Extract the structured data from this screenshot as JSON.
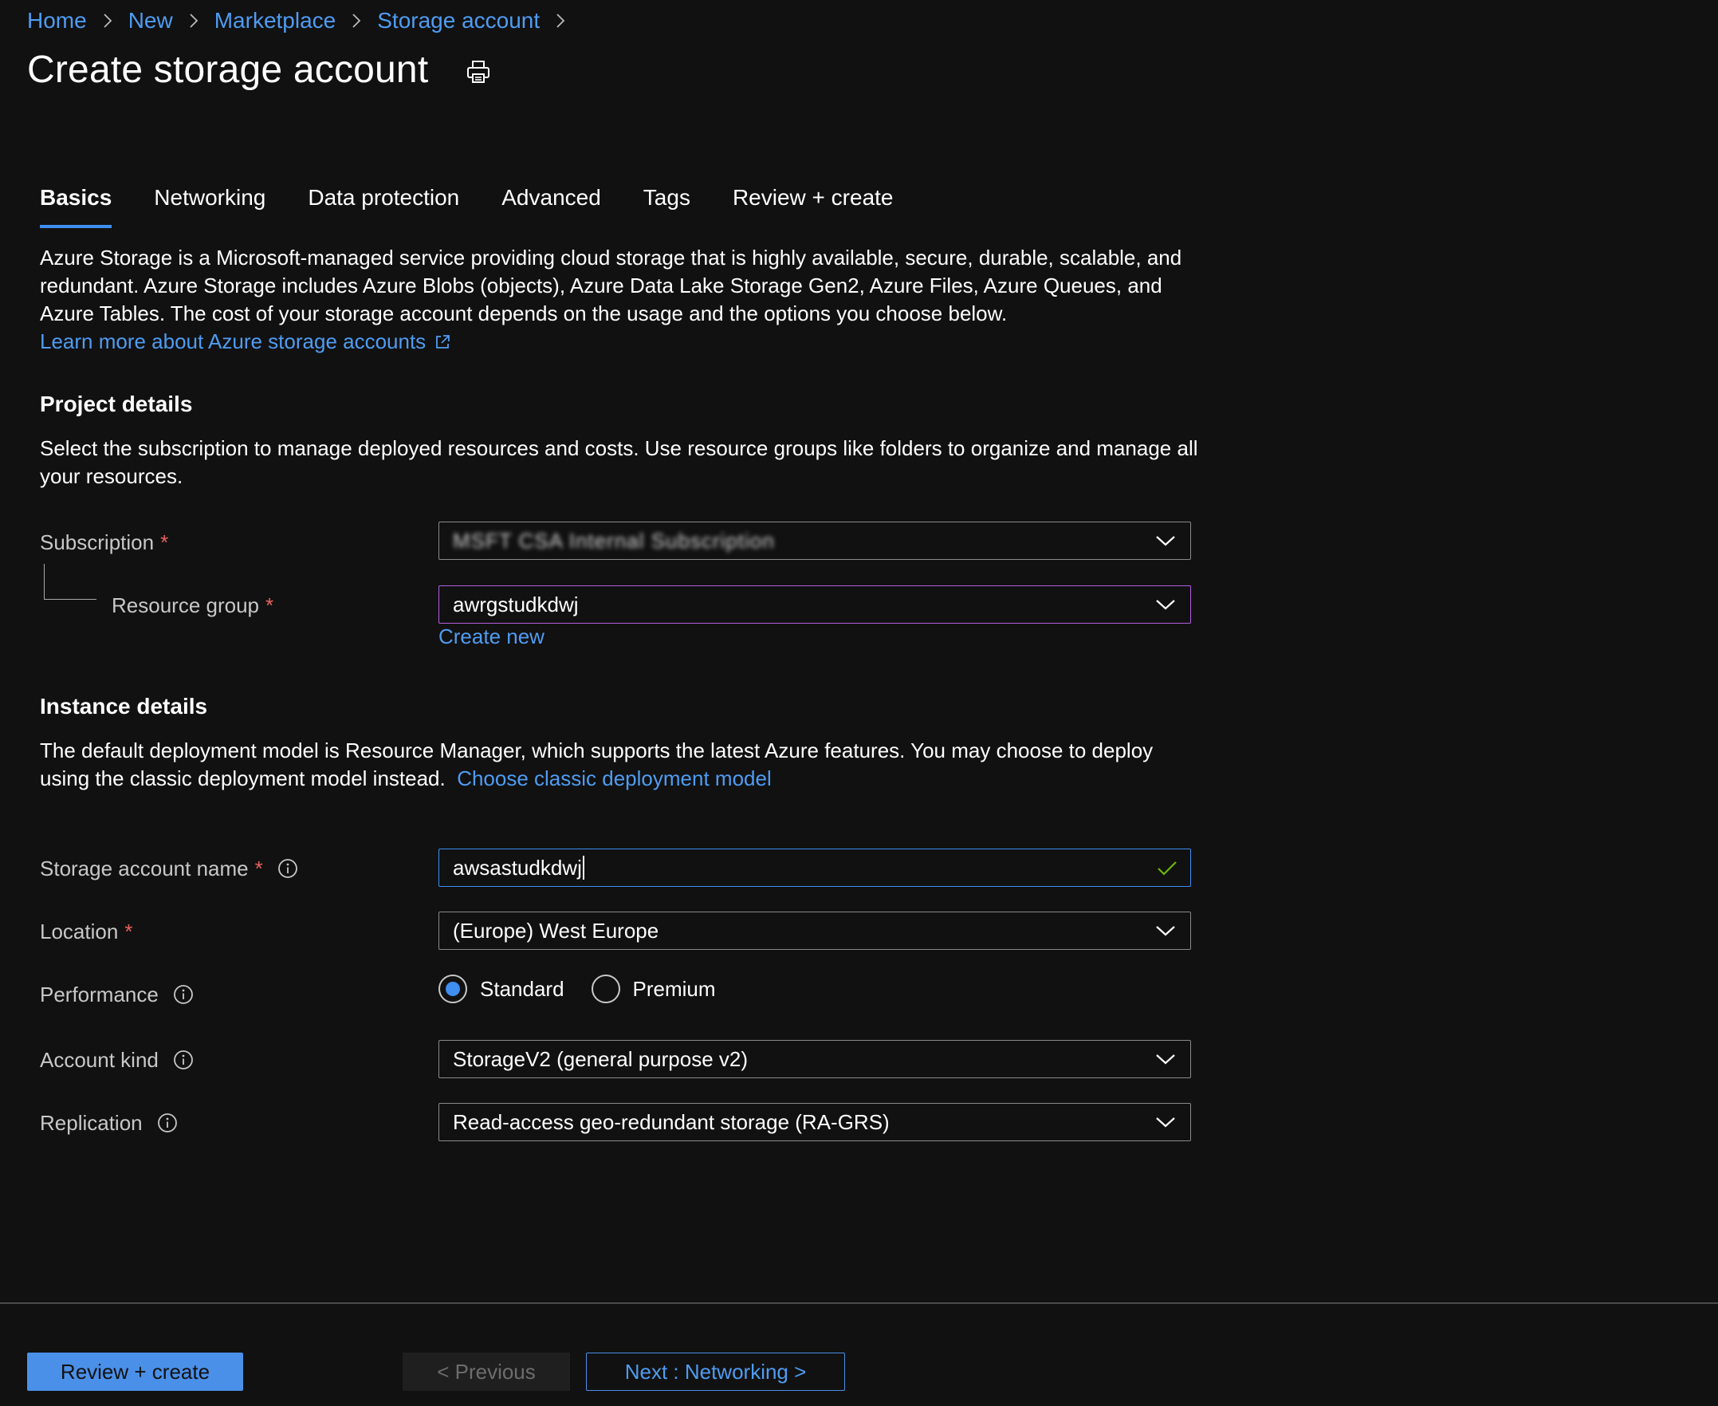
{
  "breadcrumb": {
    "items": [
      {
        "label": "Home"
      },
      {
        "label": "New"
      },
      {
        "label": "Marketplace"
      },
      {
        "label": "Storage account"
      }
    ]
  },
  "header": {
    "title": "Create storage account",
    "print_icon": "print-icon"
  },
  "tabs": [
    {
      "label": "Basics",
      "active": true
    },
    {
      "label": "Networking"
    },
    {
      "label": "Data protection"
    },
    {
      "label": "Advanced"
    },
    {
      "label": "Tags"
    },
    {
      "label": "Review + create"
    }
  ],
  "intro": {
    "text": "Azure Storage is a Microsoft-managed service providing cloud storage that is highly available, secure, durable, scalable, and redundant. Azure Storage includes Azure Blobs (objects), Azure Data Lake Storage Gen2, Azure Files, Azure Queues, and Azure Tables. The cost of your storage account depends on the usage and the options you choose below.",
    "learn_more": "Learn more about Azure storage accounts"
  },
  "project": {
    "heading": "Project details",
    "description": "Select the subscription to manage deployed resources and costs. Use resource groups like folders to organize and manage all your resources.",
    "subscription": {
      "label": "Subscription",
      "required": "*",
      "value": "MSFT CSA Internal Subscription"
    },
    "resource_group": {
      "label": "Resource group",
      "required": "*",
      "value": "awrgstudkdwj",
      "create_new": "Create new"
    }
  },
  "instance": {
    "heading": "Instance details",
    "description": "The default deployment model is Resource Manager, which supports the latest Azure features. You may choose to deploy using the classic deployment model instead.",
    "classic_link": "Choose classic deployment model",
    "storage_name": {
      "label": "Storage account name",
      "required": "*",
      "value": "awsastudkdwj"
    },
    "location": {
      "label": "Location",
      "required": "*",
      "value": "(Europe) West Europe"
    },
    "performance": {
      "label": "Performance",
      "options": [
        "Standard",
        "Premium"
      ],
      "selected": "Standard"
    },
    "account_kind": {
      "label": "Account kind",
      "value": "StorageV2 (general purpose v2)"
    },
    "replication": {
      "label": "Replication",
      "value": "Read-access geo-redundant storage (RA-GRS)"
    }
  },
  "footer": {
    "review_create": "Review + create",
    "previous": "< Previous",
    "next": "Next : Networking >"
  },
  "colors": {
    "background": "#111111",
    "link": "#4f9cf2",
    "accent": "#3f8ef0",
    "required": "#e86161",
    "valid_check": "#6bb700",
    "focus_border": "#b45ee0"
  }
}
